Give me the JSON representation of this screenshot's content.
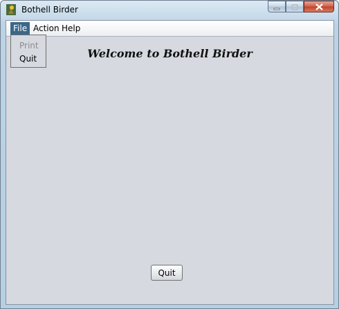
{
  "window": {
    "title": "Bothell Birder",
    "icon": "bird-app-icon",
    "controls": [
      "minimize-icon",
      "maximize-icon",
      "close-icon"
    ]
  },
  "menubar": {
    "items": [
      {
        "label": "File",
        "active": true
      },
      {
        "label": "Action"
      },
      {
        "label": "Help"
      }
    ]
  },
  "file_menu": {
    "items": [
      {
        "label": "Print",
        "enabled": false
      },
      {
        "label": "Quit",
        "enabled": true
      }
    ]
  },
  "main": {
    "heading": "Welcome to Bothell Birder",
    "quit_button": "Quit"
  },
  "colors": {
    "menu_active": "#3b6788",
    "client_bg": "#d6d9df",
    "disabled_text": "#8c8c8c"
  }
}
